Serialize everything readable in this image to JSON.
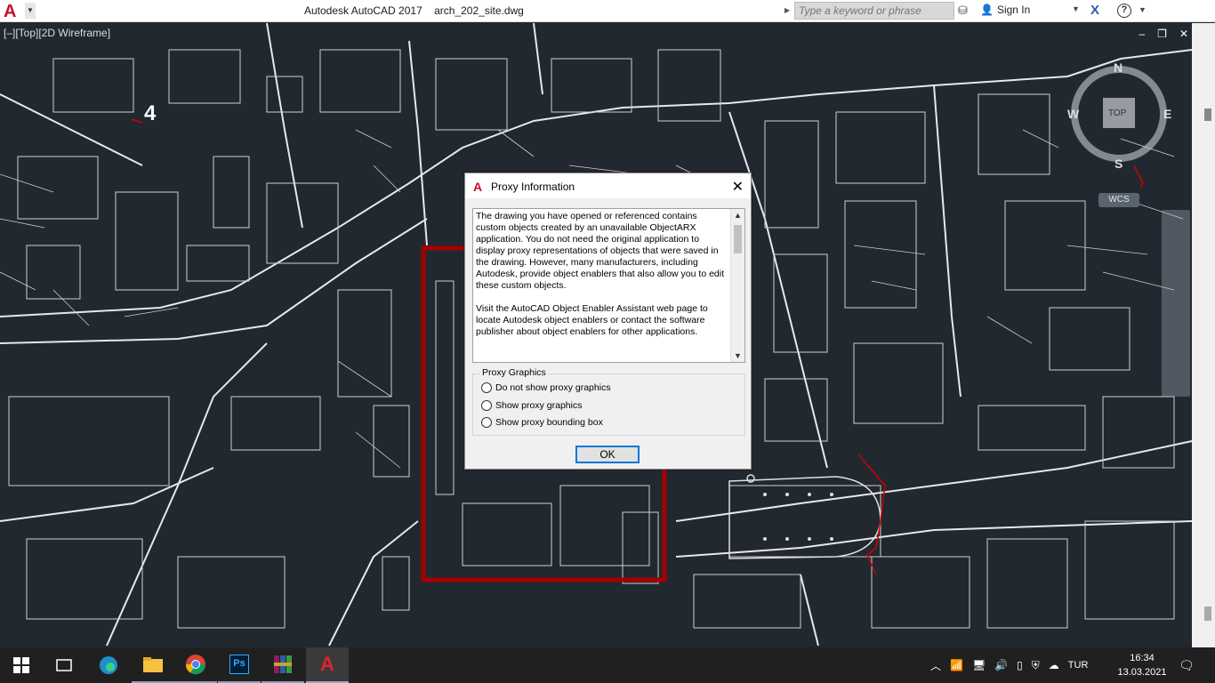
{
  "titlebar": {
    "app_logo": "A",
    "app_title": "Autodesk AutoCAD 2017",
    "file_name": "arch_202_site.dwg",
    "search_placeholder": "Type a keyword or phrase",
    "sign_in": "Sign In",
    "exchange_icon": "X",
    "help_icon": "?"
  },
  "viewport": {
    "label": "[–][Top][2D Wireframe]",
    "drawing_number": "4",
    "wcs": "WCS",
    "viewcube": {
      "top": "TOP",
      "north": "N",
      "south": "S",
      "east": "E",
      "west": "W"
    },
    "window_controls": [
      "–",
      "❐",
      "✕"
    ]
  },
  "dialog": {
    "title": "Proxy Information",
    "paragraph_1": "The drawing you have opened or referenced contains custom objects created by an unavailable ObjectARX application. You do not need the original application to display proxy representations of objects that were saved in the drawing. However, many manufacturers, including Autodesk, provide object enablers that also allow you to edit these custom objects.",
    "paragraph_2": "Visit the AutoCAD Object Enabler Assistant web page to locate Autodesk object enablers or contact the software publisher about object enablers for other applications.",
    "group_label": "Proxy Graphics",
    "options": [
      "Do not show proxy graphics",
      "Show proxy graphics",
      "Show proxy bounding box"
    ],
    "ok_label": "OK"
  },
  "taskbar": {
    "apps": [
      "windows-start",
      "task-view",
      "edge",
      "file-explorer",
      "chrome",
      "photoshop",
      "winrar",
      "autocad"
    ],
    "photoshop_label": "Ps",
    "autocad_label": "A",
    "language": "TUR",
    "time": "16:34",
    "date": "13.03.2021"
  },
  "colors": {
    "canvas": "#212830",
    "highlight_red": "#a50000",
    "taskbar": "#202020",
    "accent": "#0078d7"
  }
}
